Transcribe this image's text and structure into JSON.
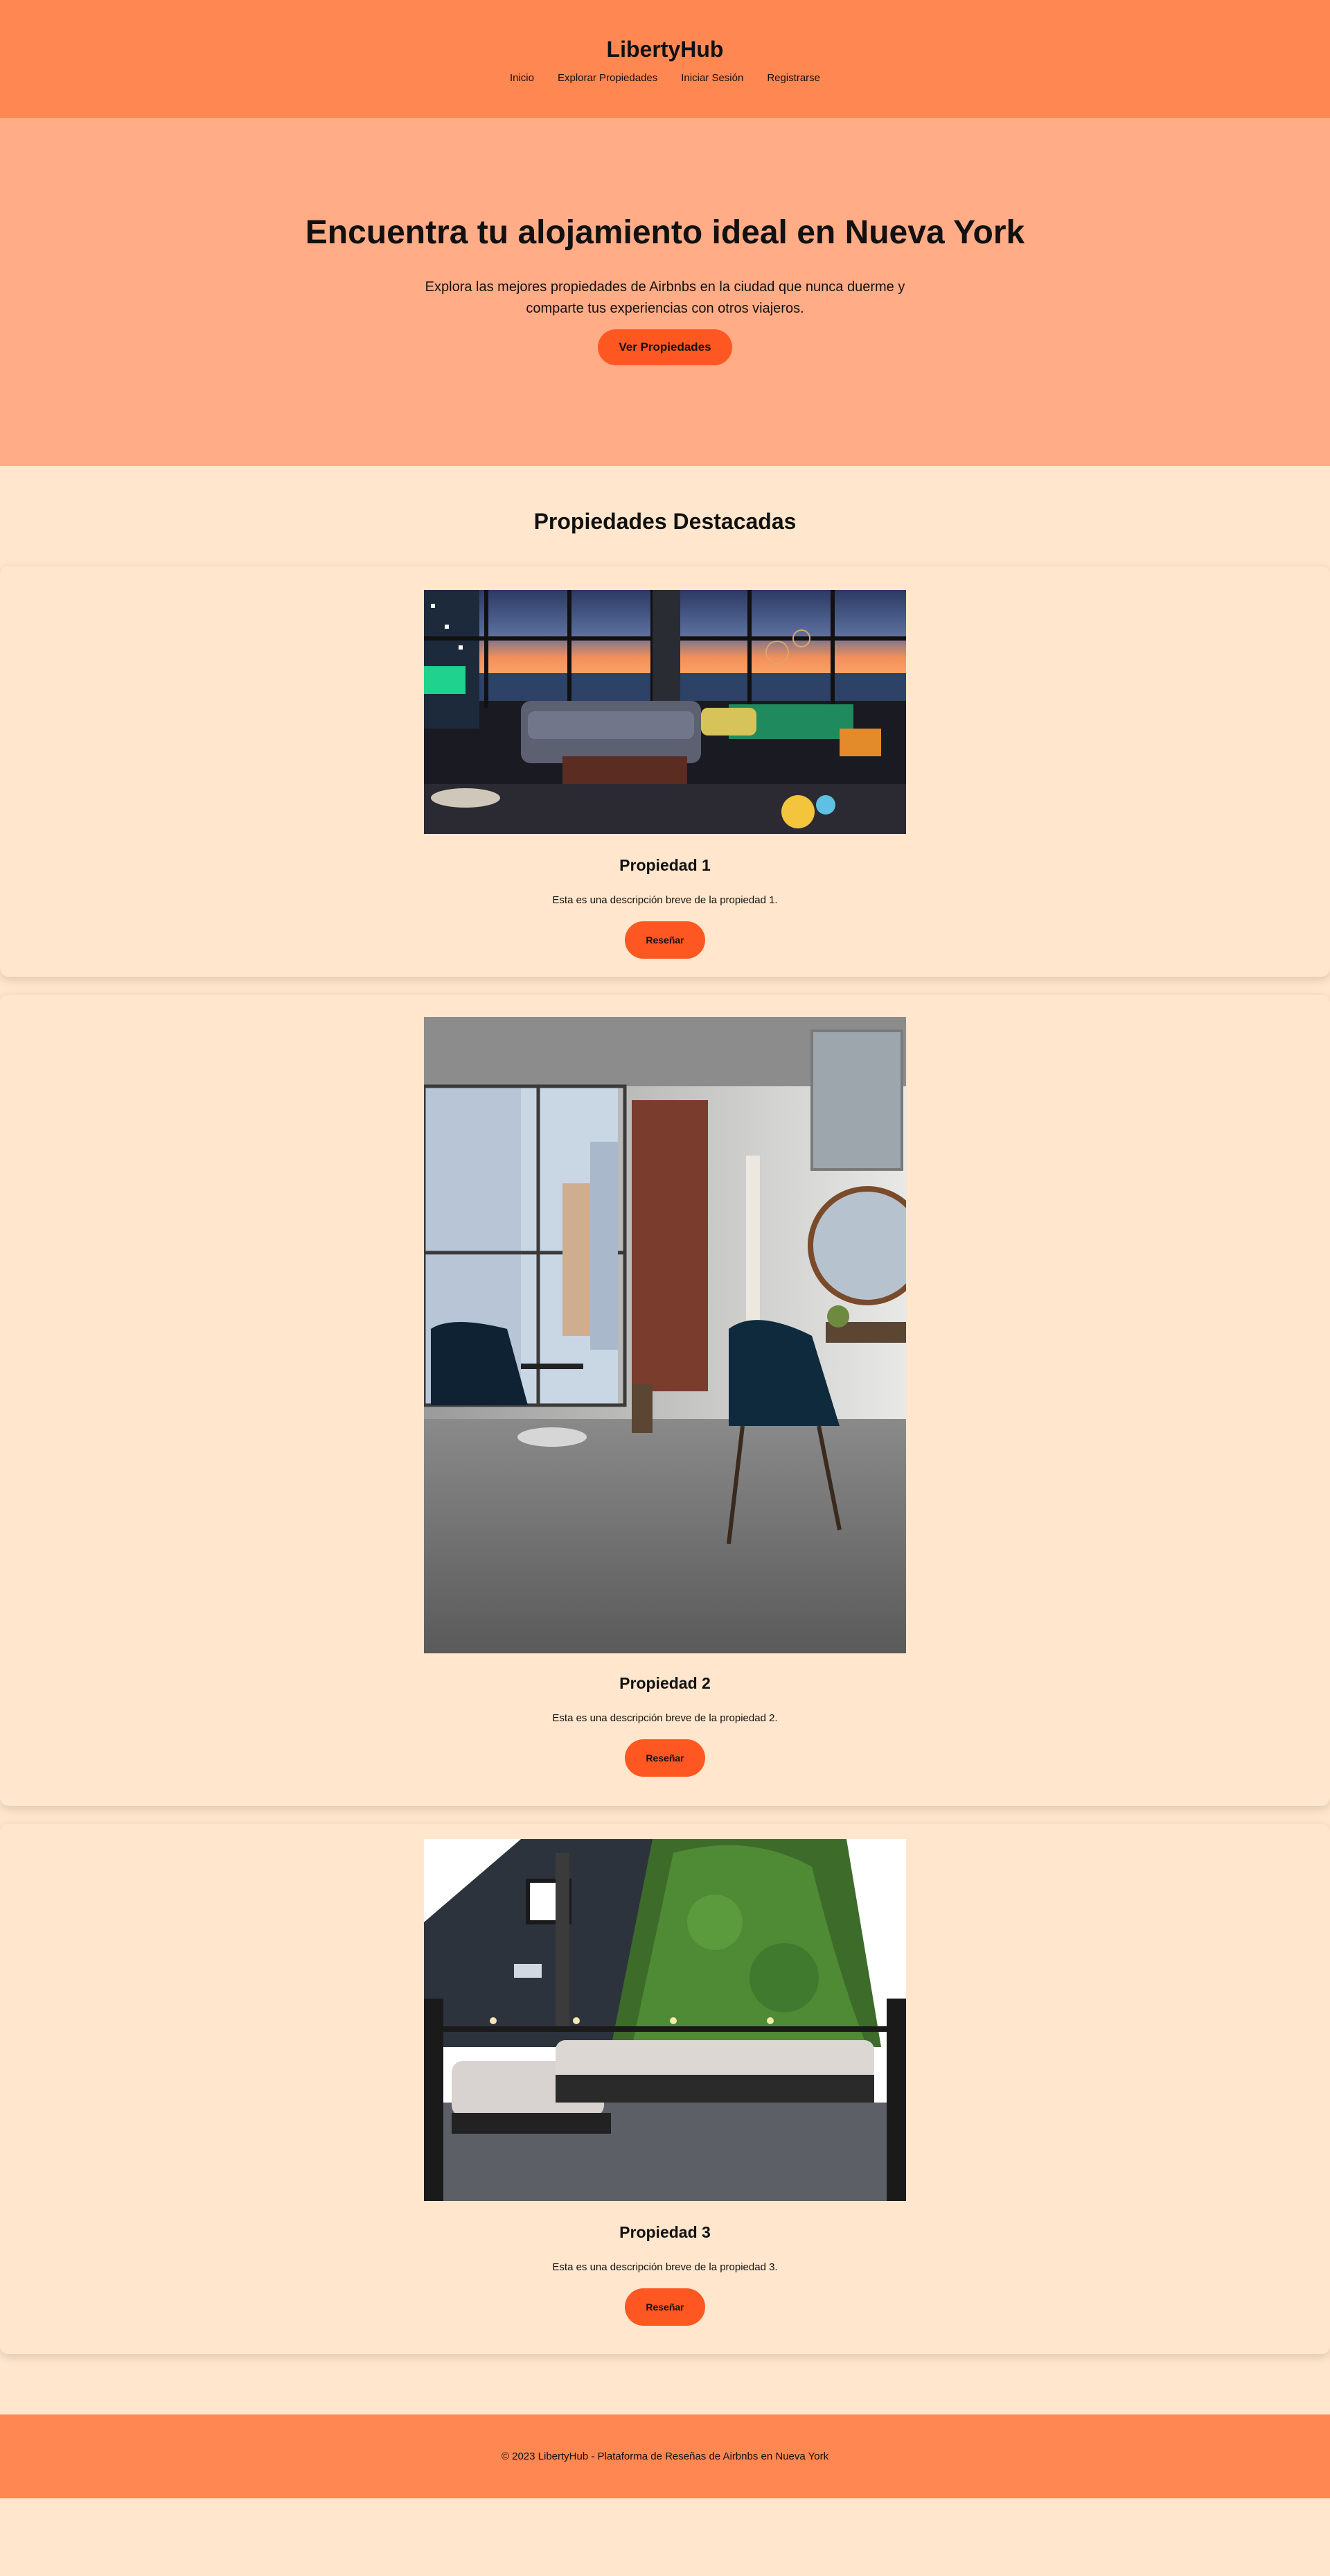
{
  "header": {
    "brand": "LibertyHub",
    "nav": [
      "Inicio",
      "Explorar Propiedades",
      "Iniciar Sesión",
      "Registrarse"
    ]
  },
  "hero": {
    "title": "Encuentra tu alojamiento ideal en Nueva York",
    "subtitle": "Explora las mejores propiedades de Airbnbs en la ciudad que nunca duerme y comparte tus experiencias con otros viajeros.",
    "cta": "Ver Propiedades"
  },
  "featured": {
    "title": "Propiedades Destacadas",
    "properties": [
      {
        "name": "Propiedad 1",
        "description": "Esta es una descripción breve de la propiedad 1.",
        "button": "Reseñar"
      },
      {
        "name": "Propiedad 2",
        "description": "Esta es una descripción breve de la propiedad 2.",
        "button": "Reseñar"
      },
      {
        "name": "Propiedad 3",
        "description": "Esta es una descripción breve de la propiedad 3.",
        "button": "Reseñar"
      }
    ]
  },
  "footer": {
    "text": "© 2023 LibertyHub - Plataforma de Reseñas de Airbnbs en Nueva York"
  },
  "colors": {
    "header": "#ff8752",
    "hero": "#ffac87",
    "page": "#ffe6cc",
    "accent": "#ff5722"
  }
}
